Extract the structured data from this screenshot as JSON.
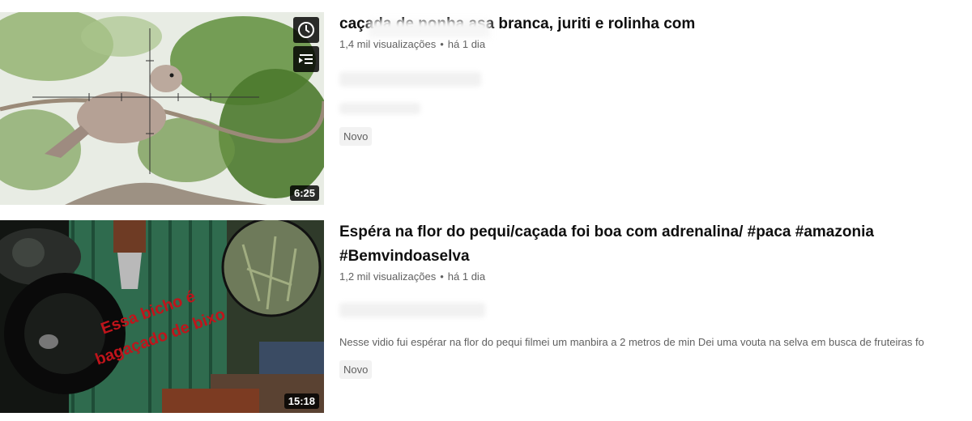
{
  "videos": [
    {
      "title": "caçada de ponba asa branca, juriti e rolinha com",
      "views": "1,4 mil visualizações",
      "age": "há 1 dia",
      "duration": "6:25",
      "description": "",
      "badge": "Novo",
      "hover_icons": [
        "clock-icon",
        "add-to-queue-icon"
      ]
    },
    {
      "title_line1": "Espéra na flor do pequi/caçada foi boa com adrenalina/ #paca #amazonia",
      "title_line2": "#Bemvindoaselva",
      "views": "1,2 mil visualizações",
      "age": "há 1 dia",
      "duration": "15:18",
      "description": "Nesse vidio fui espérar na flor do pequi filmei um manbira a 2 metros de min Dei uma vouta na selva em busca de fruteiras fo",
      "badge": "Novo",
      "overlay_text_line1": "Essa bicho é",
      "overlay_text_line2": "bagaçado de bixo"
    }
  ],
  "colors": {
    "title": "#0f0f0f",
    "meta": "#606060",
    "badge_bg": "#f2f2f2",
    "overlay_text": "#c0141b"
  }
}
